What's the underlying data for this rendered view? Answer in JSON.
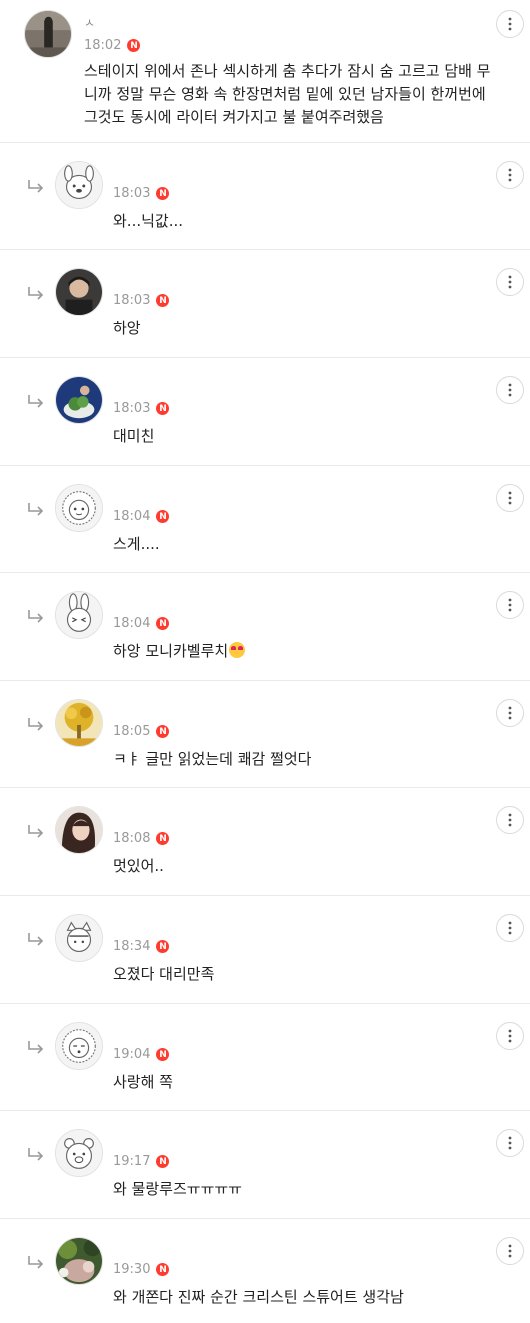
{
  "top_comment": {
    "username": "ㅅ",
    "time": "18:02",
    "badge": "N",
    "lines": [
      "스테이지 위에서 존나 섹시하게 춤 추다가 잠시 숨 고르고 담배 무",
      "니까 정말 무슨 영화 속 한장면처럼 밑에 있던 남자들이 한꺼번에",
      "그것도 동시에 라이터 켜가지고 불 붙여주려했음"
    ]
  },
  "replies": [
    {
      "time": "18:03",
      "badge": "N",
      "text": "와...닉값..."
    },
    {
      "time": "18:03",
      "badge": "N",
      "text": "하앙"
    },
    {
      "time": "18:03",
      "badge": "N",
      "text": "대미친"
    },
    {
      "time": "18:04",
      "badge": "N",
      "text": "스게...."
    },
    {
      "time": "18:04",
      "badge": "N",
      "text": "하앙 모니카벨루치"
    },
    {
      "time": "18:05",
      "badge": "N",
      "text": "ㅋㅑ 글만 읽었는데 쾌감 쩔엇다"
    },
    {
      "time": "18:08",
      "badge": "N",
      "text": "멋있어.."
    },
    {
      "time": "18:34",
      "badge": "N",
      "text": "오졌다 대리만족"
    },
    {
      "time": "19:04",
      "badge": "N",
      "text": "사랑해 쪽"
    },
    {
      "time": "19:17",
      "badge": "N",
      "text": "와 물랑루즈ㅠㅠㅠㅠ"
    },
    {
      "time": "19:30",
      "badge": "N",
      "text": "와 개쫀다 진짜 순간 크리스틴 스튜어트 생각남"
    }
  ],
  "icons": {
    "reply": "reply-arrow-icon",
    "more": "more-vertical-icon",
    "emoji": "heart-eyes-emoji"
  },
  "colors": {
    "badge": "#ff3b30",
    "divider": "#e9e9e9",
    "time": "#999999"
  }
}
